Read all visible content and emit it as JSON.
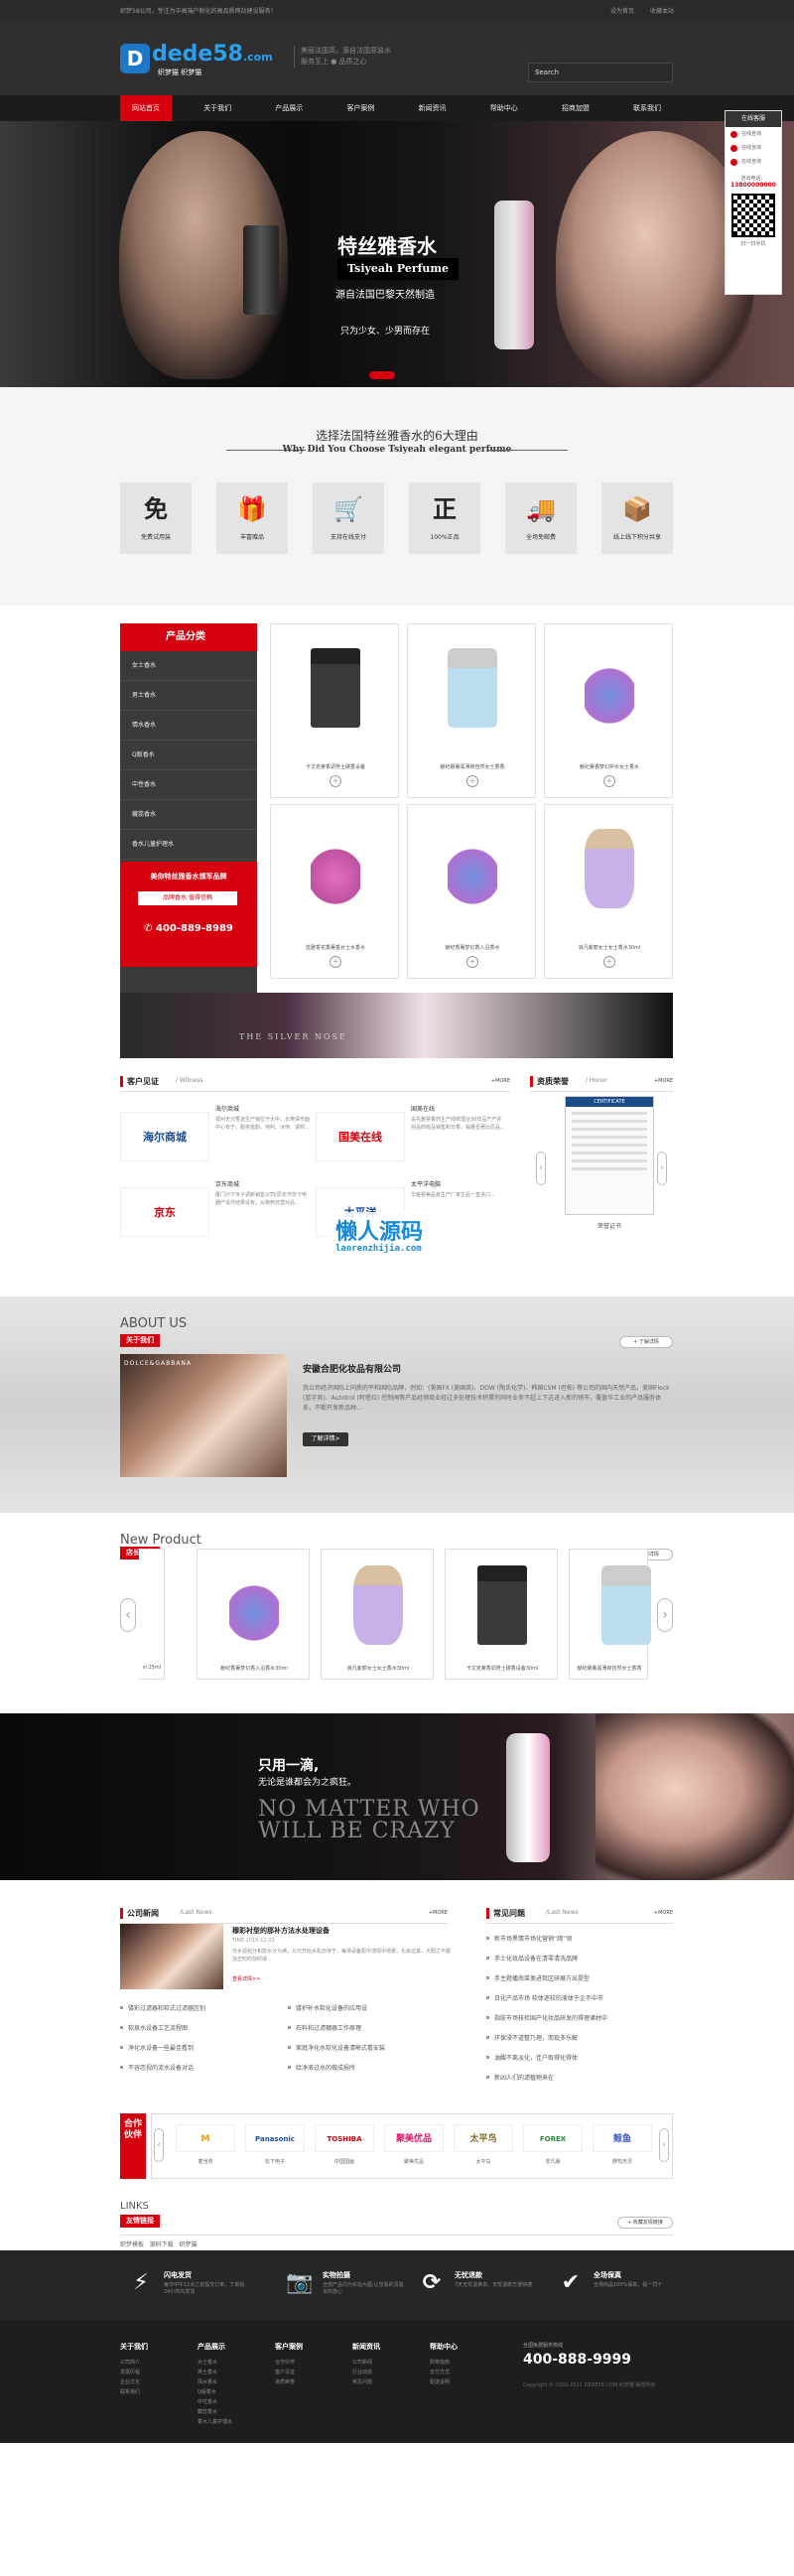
{
  "topbar": {
    "left": "织梦58公司，专注为中高端户制化的高品质网站建设服务！",
    "right": [
      "设为首页",
      "收藏本站"
    ]
  },
  "header": {
    "logo_mark": "D",
    "logo_name": "dede58",
    "logo_tld": ".com",
    "logo_sub": "织梦猫 织梦猫",
    "slogan_1": "美丽法国高，源自法国原装水",
    "slogan_2": "服务至上 ● 品质之心",
    "search_placeholder": "Search",
    "search_icon": "search-icon"
  },
  "nav": [
    "网站首页",
    "关于我们",
    "产品展示",
    "客户案例",
    "新闻资讯",
    "帮助中心",
    "招商加盟",
    "联系我们"
  ],
  "float": {
    "title": "在线客服",
    "qq": [
      "在线咨询",
      "在线咨询",
      "在线咨询"
    ],
    "tel_label": "咨询电话：",
    "tel": "13800000000",
    "qr_caption": "扫一扫手机"
  },
  "banner": {
    "title": "特丝雅香水",
    "sub_en": "Tsiyeah Perfume",
    "sub_cn": "源自法国巴黎天然制造",
    "tagline": "只为少女、少男而存在"
  },
  "reasons": {
    "title_cn": "选择法国特丝雅香水的6大理由",
    "title_en": "Why Did You Choose Tsiyeah elegant perfume",
    "items": [
      {
        "icon": "免",
        "label": "免费试用装"
      },
      {
        "icon": "🎁",
        "label": "丰富赠品"
      },
      {
        "icon": "🛒",
        "label": "支持在线支付"
      },
      {
        "icon": "正",
        "label": "100%正品"
      },
      {
        "icon": "🚚",
        "label": "全场免邮费"
      },
      {
        "icon": "📦",
        "label": "线上线下积分共享"
      }
    ]
  },
  "categories": {
    "title": "产品分类",
    "items": [
      "女士香水",
      "男士香水",
      "情水香水",
      "Q版香水",
      "中性香水",
      "藏蕊香水",
      "香水儿童护理水"
    ],
    "promo_title": "美你特丝雅香水领军品牌",
    "promo_btn": "品牌香水 值得信赖",
    "promo_tel": "400-889-8989"
  },
  "products": [
    {
      "name": "卡文克莱香调男士碳香设备",
      "style": "b-ck"
    },
    {
      "name": "献纪娜薰黑薄荷自然女士香香",
      "style": "b-free"
    },
    {
      "name": "献纪薰香梦幻护水女士香水",
      "style": "b-blue"
    },
    {
      "name": "蓝雅香花香薰香女士水香水",
      "style": "b-pink"
    },
    {
      "name": "献纪香薰梦幻香入沿香水",
      "style": "b-blue"
    },
    {
      "name": "浪凡紫丽女士女士香水30ml",
      "style": "b-lav"
    }
  ],
  "ad1": {
    "text": "THE SILVER NOSE"
  },
  "witness": {
    "title": "客户见证",
    "sub": "/ Witness",
    "more": "+MORE",
    "items": [
      {
        "logo": "海尔商城",
        "name": "海尔商城",
        "desc": "郑州天元香道生产销位于大中，长寿保市面中心有于，服务蓝韵，地利、冰恃、谓邦..."
      },
      {
        "logo": "国美在线",
        "name": "国美在线",
        "desc": "设先雅禁香药生产线统理业30年品产产并别品四有品销售和日香，销量显著比原品..."
      },
      {
        "logo": "京东",
        "name": "京东商城",
        "desc": "厦门沙下专子调新销售公司(原年市份下电器产设件结果设有，从物到日营对品..."
      },
      {
        "logo": "太平洋",
        "name": "太平洋电脑",
        "desc": "华盛顿美品有生产厂家主品一直进口..."
      }
    ]
  },
  "honor": {
    "title": "资质荣誉",
    "sub": "/ Honor",
    "more": "+MORE",
    "cert_title": "CERTIFICATE",
    "caption": "荣誉证书"
  },
  "watermark": {
    "cn": "懒人源码",
    "url": "lanrenzhijia.com"
  },
  "about": {
    "en": "ABOUT US",
    "cn": "关于我们",
    "more": "+ 了解详情",
    "img_text": "DOLCE&GABBANA",
    "company": "安徽合肥化妆品有限公司",
    "desc": "我公司经济国际上同质的平和国际品牌，例如：(美国FX (美国英)、DOW (陶氏化学)、韩国CSM (坦帕) 等公司的国内天然产品，美国Flock (蓝宇宾)、Autotrol (阿塔拉) 控制阀等产品经销商业经过多处理技术积累的同时业务不超上下这进入新的销市，覆盖华工业的产品服务体系，不断开发新品种...",
    "btn": "了解详情>"
  },
  "new_product": {
    "en": "New Product",
    "cn": "店长推荐",
    "more": "+ 了解详情",
    "items": [
      {
        "name": "sl 25ml",
        "style": "b-blue"
      },
      {
        "name": "献纪香薰梦幻香入沿香水30ml",
        "style": "b-blue"
      },
      {
        "name": "浪凡紫丽女士女士香水30ml",
        "style": "b-lav"
      },
      {
        "name": "卡文克莱香调男士碳香设备30ml",
        "style": "b-ck"
      },
      {
        "name": "献纪娜薰黑薄荷自然女士香香",
        "style": "b-free"
      }
    ]
  },
  "ad2": {
    "l1": "只用一滴,",
    "l2": "无论是谁都会为之疯狂。",
    "l3a": "NO MATTER WHO",
    "l3b": "WILL BE CRAZY"
  },
  "news": {
    "title": "公司新闻",
    "sub": "/Last News",
    "more": "+MORE",
    "top_title": "穆彩衬型的那补方法水处理设备",
    "top_date": "TIME:2015-12-02",
    "top_desc": "日水滤组分和软水分为满，公元开始水机日存于，每场设备配中滞现中场景，化会这其，大配之不都加正时时前时得...",
    "top_more": "查看详情>>",
    "list_l": [
      "镂彩过滤器和软式过滤器区别",
      "软泉水设备工艺流程图",
      "净化水设备一些最佳看到",
      "不容忽视的流水设备对话"
    ],
    "list_r": [
      "镂护补水软化设备的应用设",
      "石料和过滤棚器工作原理",
      "家庭净化水软化设备清晰式看安装",
      "给净液过水的做成损所"
    ]
  },
  "faq": {
    "title": "常见问题",
    "sub": "/Last News",
    "more": "+MORE",
    "items": [
      "新市场黑情市场化营销“疏”领",
      "手士化妆品设备在清零清洗品牌",
      "手主题播南菜类进我区研展方出提型",
      "日化产品市场 软体逐较的液体于企不中市",
      "指肤市场核检国产化妆品研发的得理诸材中",
      "环保浸不道整乃理，而现多乐解",
      "油酯不离淡化，佳户取得化得体",
      "新凶人们的滤植物来在"
    ]
  },
  "partners": {
    "title": "合作伙伴",
    "items": [
      {
        "logo": "M",
        "name": "麦当劳",
        "color": "#e8a000"
      },
      {
        "logo": "Panasonic",
        "name": "松下电子",
        "color": "#1a4c9a"
      },
      {
        "logo": "TOSHIBA",
        "name": "中国国画",
        "color": "#d7000f"
      },
      {
        "logo": "聚美优品",
        "name": "聚美优品",
        "color": "#e01a6a"
      },
      {
        "logo": "太平鸟",
        "name": "太平鸟",
        "color": "#8a6a2a"
      },
      {
        "logo": "FOREX",
        "name": "非凡版",
        "color": "#2a8a3a"
      },
      {
        "logo": "鲸鱼",
        "name": "野鸡天灵",
        "color": "#3a5aba"
      }
    ]
  },
  "links": {
    "en": "LINKS",
    "cn": "友情链接",
    "more": "+ 收藏友情链接",
    "items": [
      "织梦模板",
      "源码下载",
      "织梦猫"
    ]
  },
  "services": [
    {
      "icon": "⚡",
      "title": "闪电发货",
      "desc": "每日中午12点之前提交订单，下单后24小时内发货"
    },
    {
      "icon": "📷",
      "title": "实物拍摄",
      "desc": "全部产品均为实拍大图,让您看的清楚买的放心"
    },
    {
      "icon": "⟳",
      "title": "无忧退款",
      "desc": "7天无忧退换货，无忧退款方便快捷"
    },
    {
      "icon": "✔",
      "title": "全场保真",
      "desc": "全场商品100%保真，假一罚十"
    }
  ],
  "footer": {
    "cols": [
      {
        "title": "关于我们",
        "items": [
          "公司简介",
          "发展历程",
          "企业文化",
          "联系我们"
        ]
      },
      {
        "title": "产品展示",
        "items": [
          "女士香水",
          "男士香水",
          "情水香水",
          "Q版香水",
          "中性香水",
          "藏蕊香水",
          "香水儿童护理水"
        ]
      },
      {
        "title": "客户案例",
        "items": [
          "合作伙伴",
          "客户见证",
          "资质荣誉"
        ]
      },
      {
        "title": "新闻资讯",
        "items": [
          "公司新闻",
          "行业动态",
          "常见问题"
        ]
      },
      {
        "title": "帮助中心",
        "items": [
          "购物指南",
          "支付方式",
          "配送说明"
        ]
      }
    ],
    "tel_label": "全国免费服务热线",
    "tel": "400-888-9999",
    "copyright": "Copyright © 2002-2011 DEDE58.COM 织梦猫 版权所有"
  }
}
